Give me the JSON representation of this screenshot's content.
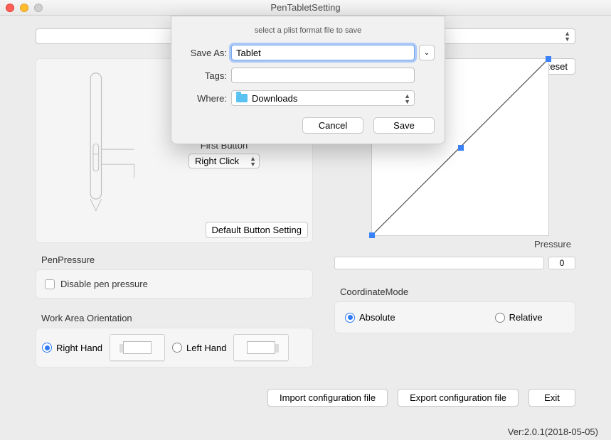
{
  "window": {
    "title": "PenTabletSetting"
  },
  "dialog": {
    "subtitle": "select a plist format file to save",
    "saveAsLabel": "Save As:",
    "saveAsValue": "Tablet",
    "tagsLabel": "Tags:",
    "tagsValue": "",
    "whereLabel": "Where:",
    "whereValue": "Downloads",
    "cancel": "Cancel",
    "save": "Save"
  },
  "buttonSetting": {
    "firstButtonLabel": "First Button",
    "firstButtonValue": "Right Click",
    "defaultBtn": "Default  Button Setting"
  },
  "penPressure": {
    "header": "PenPressure",
    "disableLabel": "Disable pen pressure"
  },
  "orientation": {
    "header": "Work Area Orientation",
    "right": "Right Hand",
    "left": "Left Hand"
  },
  "graph": {
    "reset": "Reset",
    "axisLabel": "Pressure",
    "value": "0"
  },
  "coord": {
    "header": "CoordinateMode",
    "absolute": "Absolute",
    "relative": "Relative"
  },
  "bottom": {
    "import": "Import configuration file",
    "export": "Export configuration file",
    "exit": "Exit"
  },
  "version": "Ver:2.0.1(2018-05-05)"
}
